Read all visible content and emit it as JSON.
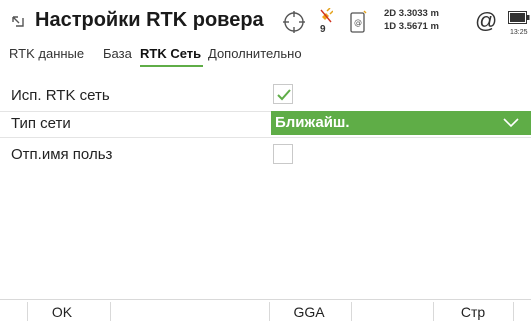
{
  "header": {
    "title": "Настройки RTK ровера",
    "satellite_count": "9",
    "precision_2d": "2D 3.3033 m",
    "precision_1d": "1D 3.5671 m",
    "at_symbol": "@",
    "time": "13:25",
    "icons": [
      "back-icon",
      "gnss-crosshair-icon",
      "satellite-icon",
      "device-connection-icon",
      "battery-icon"
    ]
  },
  "tabs": [
    {
      "label": "RTK данные",
      "active": false
    },
    {
      "label": "База",
      "active": false
    },
    {
      "label": "RTK Сеть",
      "active": true
    },
    {
      "label": "Дополнительно",
      "active": false
    }
  ],
  "form": {
    "use_rtk_network": {
      "label": "Исп. RTK сеть",
      "checked": true
    },
    "network_type": {
      "label": "Тип сети",
      "value": "Ближайш."
    },
    "send_user_name": {
      "label": "Отп.имя польз",
      "checked": false
    }
  },
  "softkeys": {
    "f1": "OK",
    "f2": "",
    "f3": "GGA",
    "f4": "",
    "f5": "Стр",
    "f6": ""
  },
  "colors": {
    "accent": "#5fad47",
    "text": "#1e1e1e",
    "separator": "#e4e4e4"
  }
}
